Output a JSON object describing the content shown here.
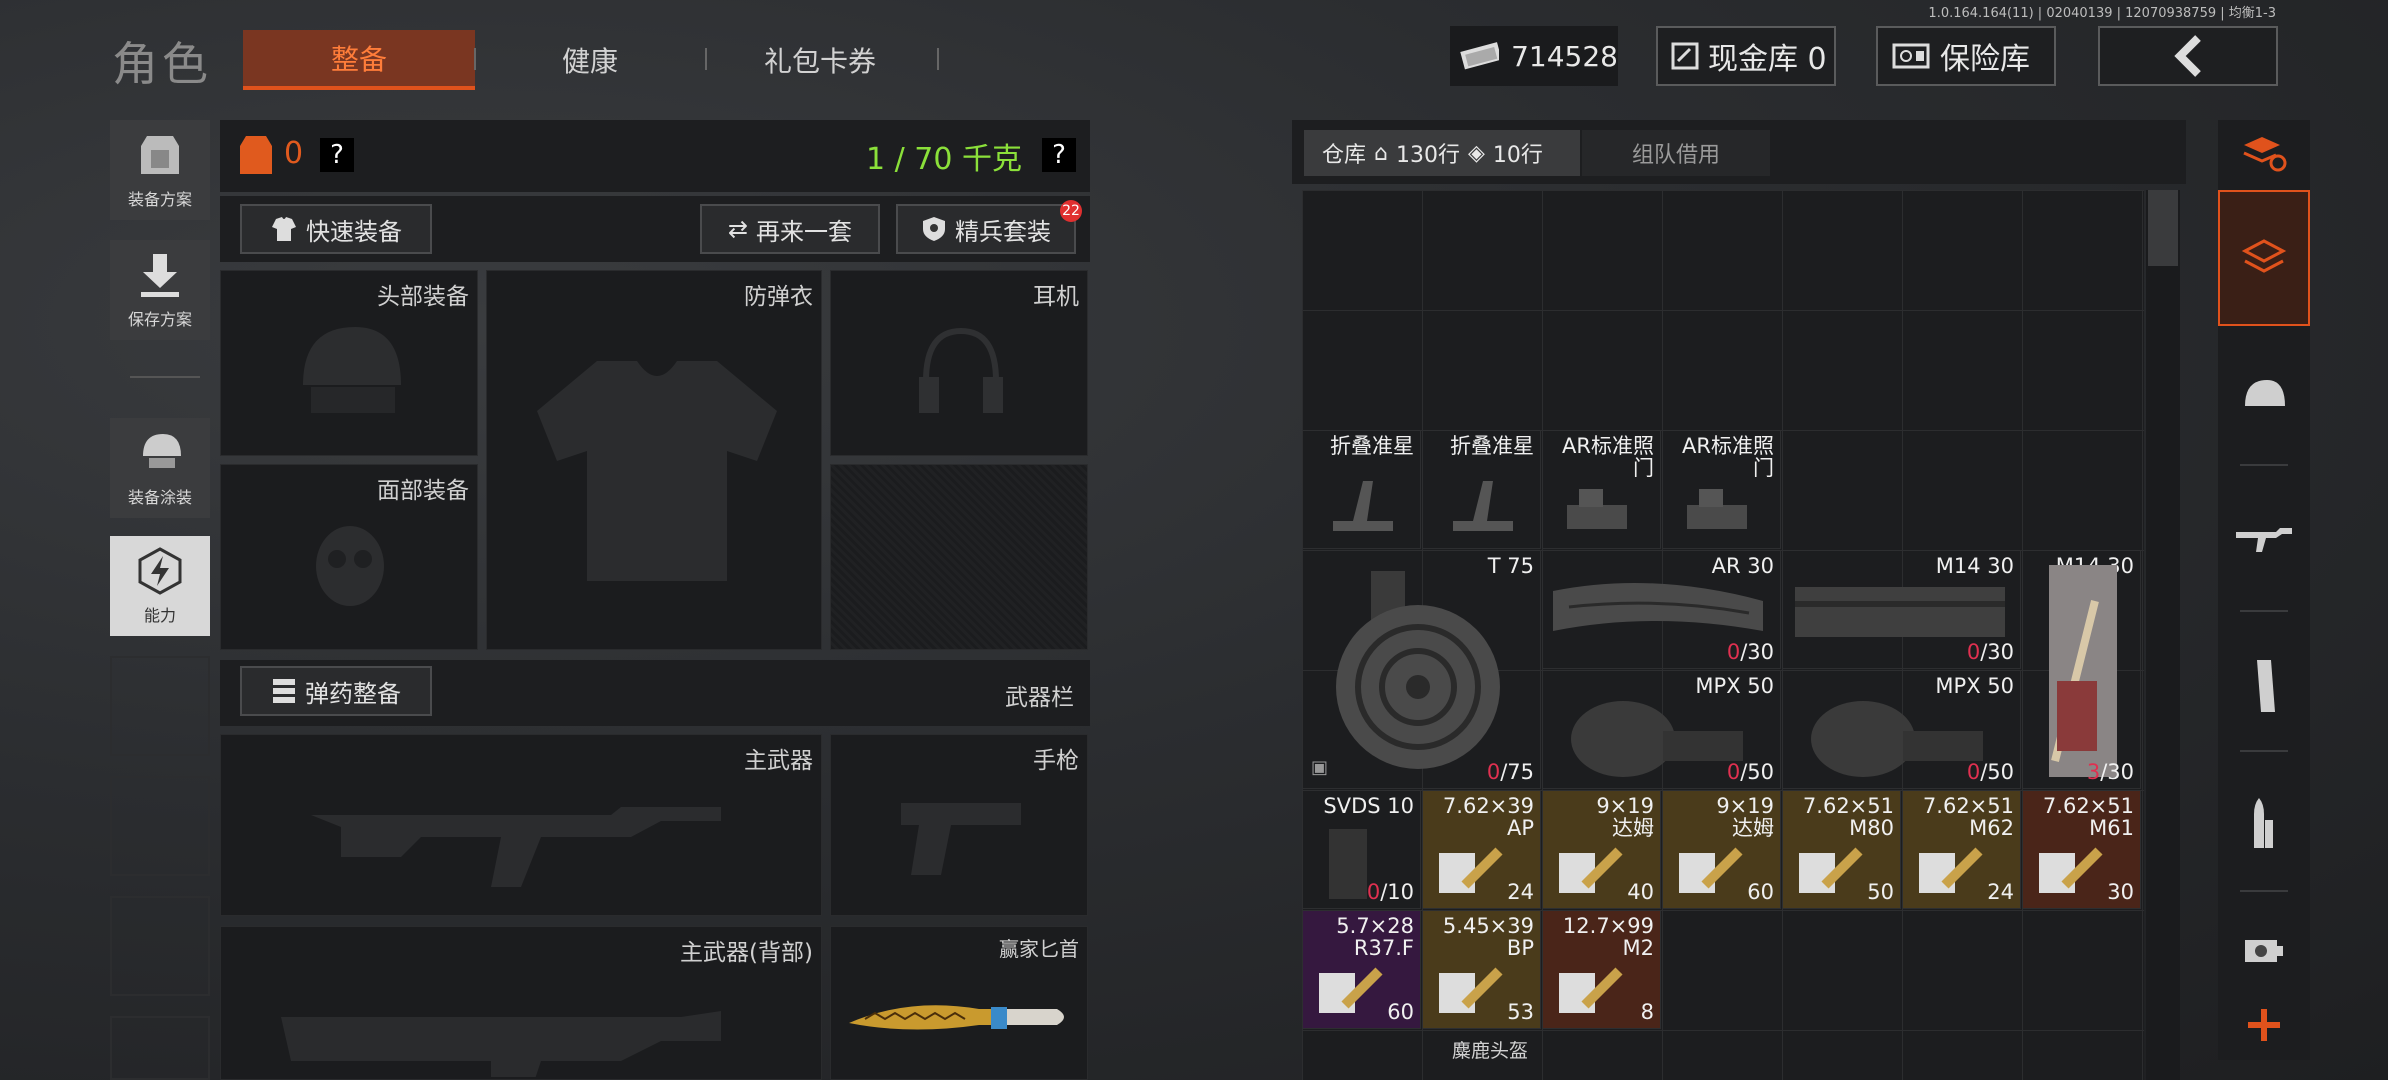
{
  "version": "1.0.164.164(11) | 02040139 | 12070938759 | 均衡1-3",
  "header": {
    "title": "角色",
    "tabs": [
      {
        "label": "整备",
        "active": true
      },
      {
        "label": "健康",
        "active": false
      },
      {
        "label": "礼包卡券",
        "active": false
      }
    ],
    "money": "714528",
    "cash_vault": "现金库 0",
    "safe": "保险库",
    "back_icon": "back-chevron-icon"
  },
  "left_sidebar": [
    {
      "label": "装备方案",
      "icon": "armor-plan-icon"
    },
    {
      "label": "保存方案",
      "icon": "save-download-icon"
    },
    {
      "label": "装备涂装",
      "icon": "paint-helmet-icon"
    },
    {
      "label": "能力",
      "icon": "ability-icon"
    }
  ],
  "equip": {
    "armor_count": "0",
    "weight": "1 / 70 千克",
    "help": "?",
    "quick_equip": "快速装备",
    "again": "再来一套",
    "elite_kit": "精兵套装",
    "elite_badge": "22",
    "slots": {
      "head": "头部装备",
      "vest": "防弹衣",
      "headset": "耳机",
      "face": "面部装备"
    },
    "ammo_equip": "弹药整备",
    "weapon_bar": "武器栏",
    "primary": "主武器",
    "pistol": "手枪",
    "primary_back": "主武器(背部)",
    "knife": "赢家匕首"
  },
  "warehouse": {
    "tab_label": "仓库",
    "rows": "130行",
    "tag_rows": "10行",
    "team_borrow": "组队借用",
    "items": {
      "sight1": "折叠准星",
      "sight2": "折叠准星",
      "sight3": "AR标准照门",
      "sight4": "AR标准照门",
      "t75_name": "T 75",
      "t75_zero": "0",
      "t75_cap": "/75",
      "ar30_name": "AR 30",
      "ar30_zero": "0",
      "ar30_cap": "/30",
      "m14a_name": "M14 30",
      "m14a_zero": "0",
      "m14a_cap": "/30",
      "m14b_name": "M14 30",
      "m14b_zero": "3",
      "m14b_cap": "/30",
      "mpx1_name": "MPX 50",
      "mpx1_zero": "0",
      "mpx1_cap": "/50",
      "mpx2_name": "MPX 50",
      "mpx2_zero": "0",
      "mpx2_cap": "/50",
      "svds_name": "SVDS 10",
      "svds_zero": "0",
      "svds_cap": "/10",
      "a1_name": "7.62×39\nAP",
      "a1_ct": "24",
      "a2_name": "9×19\n达姆",
      "a2_ct": "40",
      "a3_name": "9×19\n达姆",
      "a3_ct": "60",
      "a4_name": "7.62×51\nM80",
      "a4_ct": "50",
      "a5_name": "7.62×51\nM62",
      "a5_ct": "24",
      "a6_name": "7.62×51\nM61",
      "a6_ct": "30",
      "b1_name": "5.7×28\nR37.F",
      "b1_ct": "60",
      "b2_name": "5.45×39\nBP",
      "b2_ct": "53",
      "b3_name": "12.7×99\nM2",
      "b3_ct": "8",
      "next_row": "麋鹿头盔"
    }
  },
  "right_sidebar": [
    "sort-refresh-icon",
    "warehouse-stack-icon",
    "helmet-icon",
    "rifle-icon",
    "magazine-icon",
    "bullet-icon",
    "scope-icon",
    "add-icon"
  ],
  "colors": {
    "accent": "#e0521c",
    "green": "#8be03a",
    "red_count": "#e03050"
  }
}
